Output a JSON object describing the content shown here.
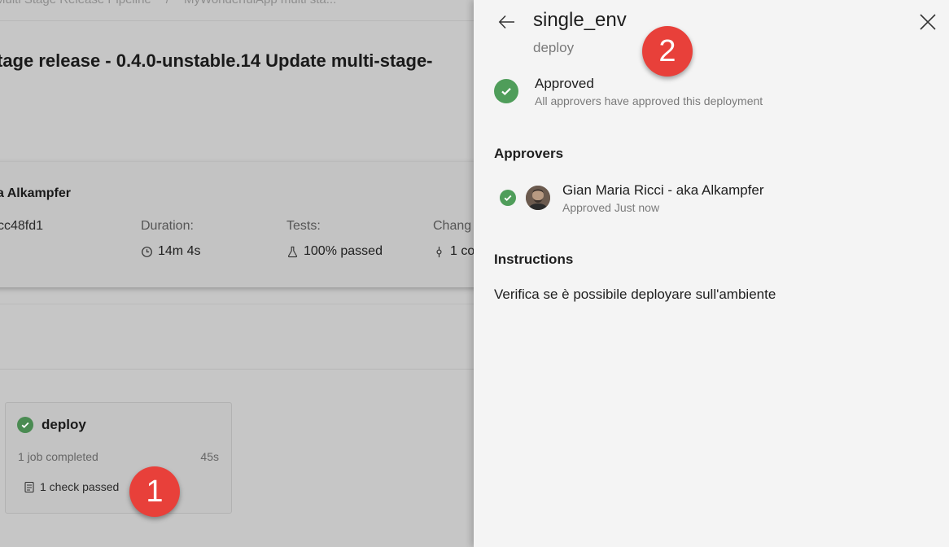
{
  "background": {
    "breadcrumb": [
      "Multi Stage Release Pipeline",
      "/",
      "MyWonderfulApp multi sta..."
    ],
    "run_title": "tage release - 0.4.0-unstable.14 Update multi-stage-",
    "summary": {
      "author": "a Alkampfer",
      "commit": "cc48fd1",
      "duration_label": "Duration:",
      "duration_value": "14m 4s",
      "tests_label": "Tests:",
      "tests_value": "100% passed",
      "changes_label": "Chang",
      "changes_value": "1 co"
    },
    "stage": {
      "name": "deploy",
      "jobs": "1 job completed",
      "duration": "45s",
      "checks": "1 check passed"
    },
    "callout_1": "1"
  },
  "panel": {
    "title": "single_env",
    "subtitle": "deploy",
    "callout_2": "2",
    "status": {
      "title": "Approved",
      "description": "All approvers have approved this deployment"
    },
    "approvers_heading": "Approvers",
    "approvers": [
      {
        "name": "Gian Maria Ricci - aka Alkampfer",
        "status": "Approved Just now"
      }
    ],
    "instructions_heading": "Instructions",
    "instructions": "Verifica se è possibile deployare sull'ambiente"
  },
  "colors": {
    "success_green": "#4f9d5a",
    "callout_red": "#e8403a",
    "panel_bg": "#f4f4f4",
    "overlay_bg": "#c6c6c6"
  },
  "icons": [
    "back-arrow-icon",
    "close-icon",
    "check-circle-icon",
    "clock-icon",
    "flask-icon",
    "commit-icon",
    "checklist-icon"
  ]
}
